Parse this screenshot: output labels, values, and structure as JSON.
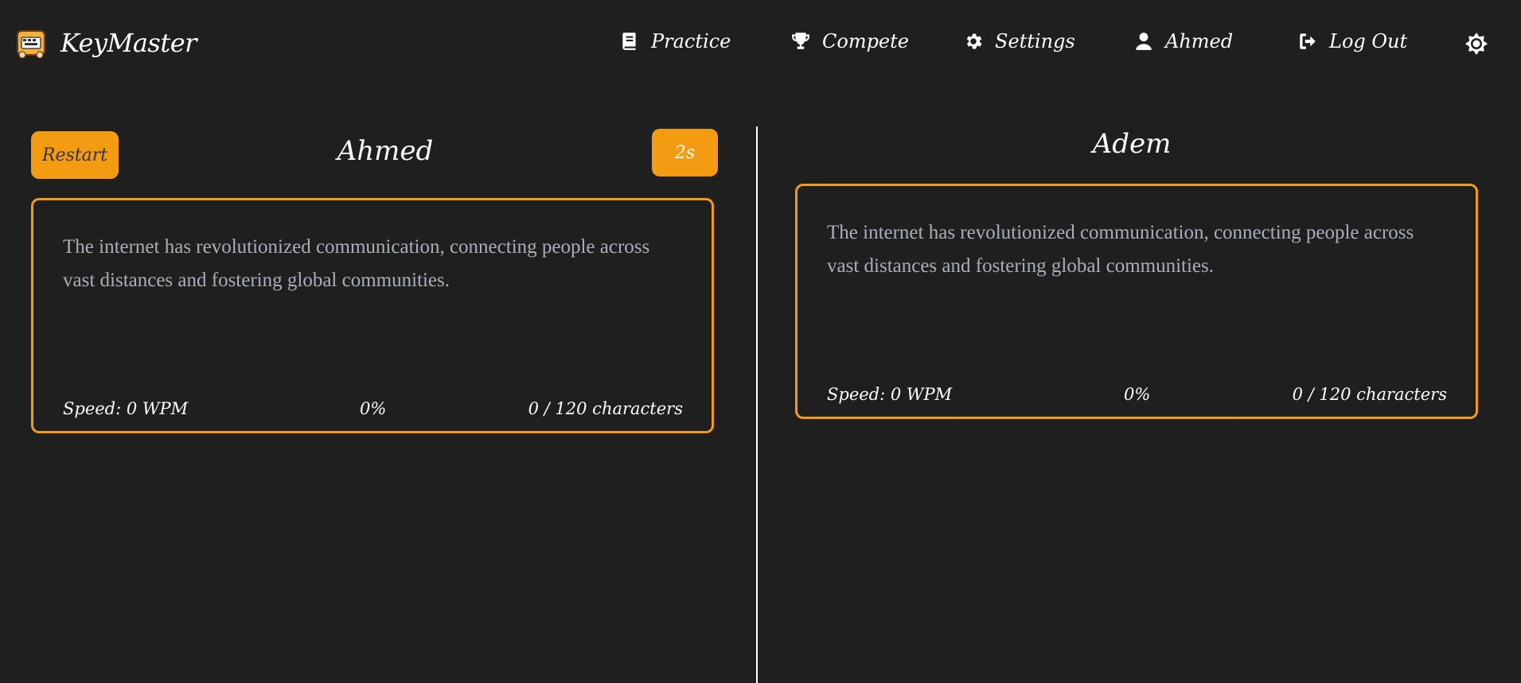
{
  "brand": {
    "name": "KeyMaster"
  },
  "nav": {
    "practice": "Practice",
    "compete": "Compete",
    "settings": "Settings",
    "user": "Ahmed",
    "logout": "Log Out"
  },
  "colors": {
    "accent": "#f39c12",
    "background": "#1f1f1f",
    "passage_text": "#a9afb9"
  },
  "local_player": {
    "name": "Ahmed",
    "restart_label": "Restart",
    "timer": "2s",
    "passage": "The internet has revolutionized communication, connecting people across vast distances and fostering global communities.",
    "speed": "Speed: 0 WPM",
    "progress": "0%",
    "chars": "0 / 120 characters"
  },
  "opponent": {
    "name": "Adem",
    "passage": "The internet has revolutionized communication, connecting people across vast distances and fostering global communities.",
    "speed": "Speed: 0 WPM",
    "progress": "0%",
    "chars": "0 / 120 characters"
  }
}
